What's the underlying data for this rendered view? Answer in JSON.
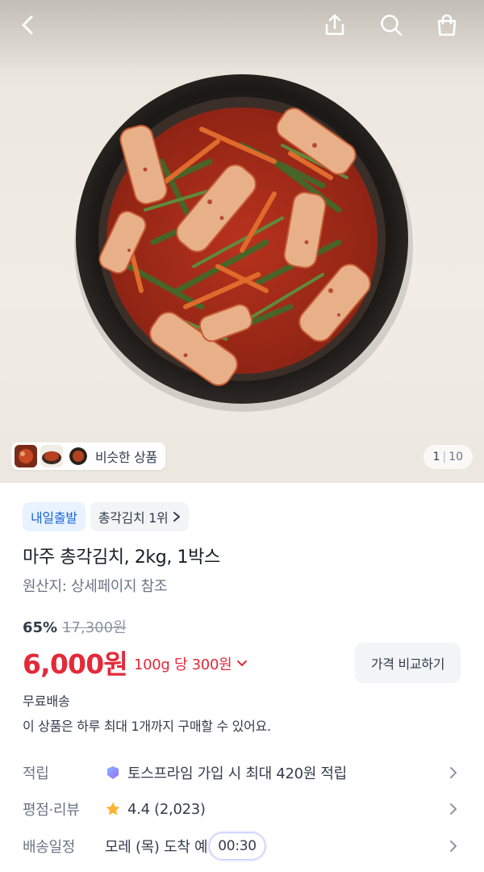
{
  "header": {
    "back_icon": "chevron-left-icon",
    "share_icon": "share-icon",
    "search_icon": "search-icon",
    "cart_icon": "shopping-bag-icon"
  },
  "hero": {
    "similar_label": "비슷한 상품",
    "pager_current": "1",
    "pager_total": "10"
  },
  "badges": {
    "delivery": "내일출발",
    "ranking": "총각김치 1위"
  },
  "product": {
    "title": "마주 총각김치, 2kg, 1박스",
    "origin": "원산지: 상세페이지 참조",
    "discount": "65%",
    "original_price": "17,300원",
    "price": "6,000원",
    "unit_price": "100g 당 300원",
    "compare_label": "가격 비교하기",
    "shipping": "무료배송",
    "limit_notice": "이 상품은 하루 최대 1개까지 구매할 수 있어요."
  },
  "info_rows": {
    "points_key": "적립",
    "points_value": "토스프라임 가입 시 최대 420원 적립",
    "rating_key": "평점·리뷰",
    "rating_value": "4.4 (2,023)",
    "delivery_key": "배송일정",
    "delivery_value": "모레 (목) 도착 예",
    "timer": "00:30"
  },
  "colors": {
    "price_red": "#e42939",
    "badge_blue": "#1b64da",
    "badge_blue_bg": "#e8f3ff",
    "star": "#ffb331"
  }
}
